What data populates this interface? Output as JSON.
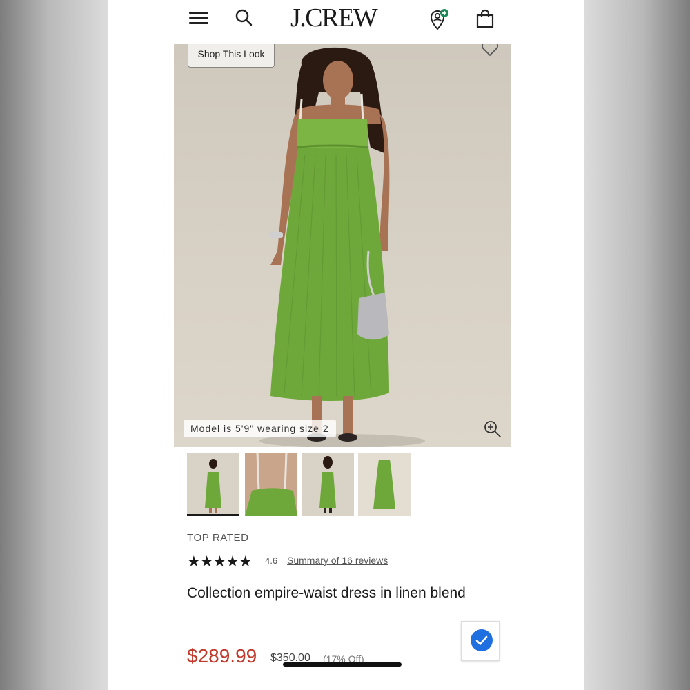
{
  "header": {
    "logo": "J.CREW",
    "icons": [
      "menu-icon",
      "search-icon",
      "account-icon",
      "bag-icon"
    ]
  },
  "hero": {
    "shop_look_label": "Shop This Look",
    "model_note": "Model is 5'9\" wearing size 2"
  },
  "thumbnails": [
    {
      "name": "front",
      "selected": true
    },
    {
      "name": "back-detail",
      "selected": false
    },
    {
      "name": "back",
      "selected": false
    },
    {
      "name": "flat",
      "selected": false
    }
  ],
  "product": {
    "badge": "TOP RATED",
    "stars": "★★★★★",
    "rating": "4.6",
    "reviews_link": "Summary of 16 reviews",
    "name": "Collection empire-waist dress in linen blend",
    "price": "$289.99",
    "was_price": "$350.00",
    "discount": "(17% Off)"
  },
  "colors": {
    "price_red": "#c0392b",
    "dress_green": "#6fa83a",
    "check_blue": "#1f6fe0"
  }
}
